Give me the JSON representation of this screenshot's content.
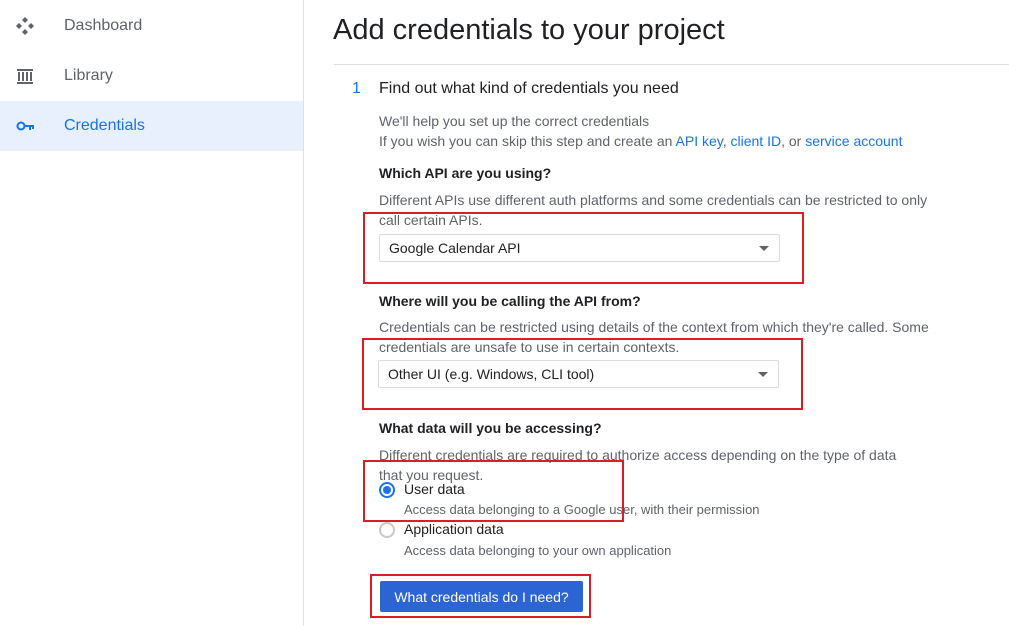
{
  "sidebar": {
    "items": [
      {
        "label": "Dashboard",
        "icon": "dashboard-icon"
      },
      {
        "label": "Library",
        "icon": "library-icon"
      },
      {
        "label": "Credentials",
        "icon": "key-icon",
        "active": true
      }
    ]
  },
  "main": {
    "title": "Add credentials to your project",
    "step": {
      "number": "1",
      "title": "Find out what kind of credentials you need",
      "intro_line1": "We'll help you set up the correct credentials",
      "intro_line2_prefix": "If you wish you can skip this step and create an ",
      "link_api_key": "API key",
      "link_client_id": "client ID",
      "or_text": ", or ",
      "link_service_account": "service account",
      "comma": ", "
    },
    "api_question": {
      "label": "Which API are you using?",
      "help": "Different APIs use different auth platforms and some credentials can be restricted to only call certain APIs.",
      "selected": "Google Calendar API"
    },
    "calling_question": {
      "label": "Where will you be calling the API from?",
      "help": "Credentials can be restricted using details of the context from which they're called. Some credentials are unsafe to use in certain contexts.",
      "selected": "Other UI (e.g. Windows, CLI tool)"
    },
    "data_question": {
      "label": "What data will you be accessing?",
      "help": "Different credentials are required to authorize access depending on the type of data that you request.",
      "options": [
        {
          "label": "User data",
          "desc": "Access data belonging to a Google user, with their permission",
          "checked": true
        },
        {
          "label": "Application data",
          "desc": "Access data belonging to your own application",
          "checked": false
        }
      ]
    },
    "submit_label": "What credentials do I need?"
  },
  "colors": {
    "accent": "#1a73e8",
    "button": "#2d64d4",
    "highlight": "#dc1d24"
  }
}
